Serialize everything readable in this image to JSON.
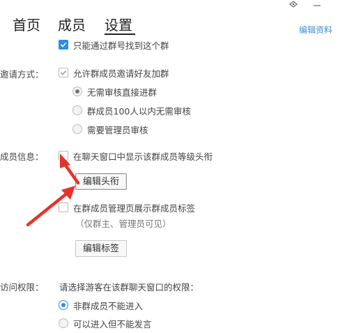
{
  "window": {
    "pin_icon": "pin-icon",
    "minimize_icon": "minimize-icon"
  },
  "tabs": [
    {
      "label": "首页"
    },
    {
      "label": "成员"
    },
    {
      "label": "设置"
    }
  ],
  "edit_profile_link": "编辑资料",
  "search_option": {
    "label": "只能通过群号找到这个群",
    "checked": true
  },
  "invite": {
    "section_label": "邀请方式：",
    "allow_label": "允许群成员邀请好友加群",
    "options": [
      {
        "label": "无需审核直接进群",
        "selected": true
      },
      {
        "label": "群成员100人以内无需审核",
        "selected": false
      },
      {
        "label": "需要管理员审核",
        "selected": false
      }
    ]
  },
  "member_info": {
    "section_label": "成员信息：",
    "show_title_label": "在聊天窗口中显示该群成员等级头衔",
    "edit_title_button": "编辑头衔",
    "show_tags_label": "在群成员管理页展示群成员标签",
    "tags_note": "（仅群主、管理员可见）",
    "edit_tags_button": "编辑标签"
  },
  "access": {
    "section_label": "访问权限：",
    "prompt": "请选择游客在该群聊天窗口的权限：",
    "options": [
      {
        "label": "非群成员不能进入",
        "selected": true
      },
      {
        "label": "可以进入但不能发言",
        "selected": false
      }
    ]
  },
  "colors": {
    "accent": "#2e8de6",
    "arrow": "#e8312a",
    "link": "#3c8fd6"
  }
}
